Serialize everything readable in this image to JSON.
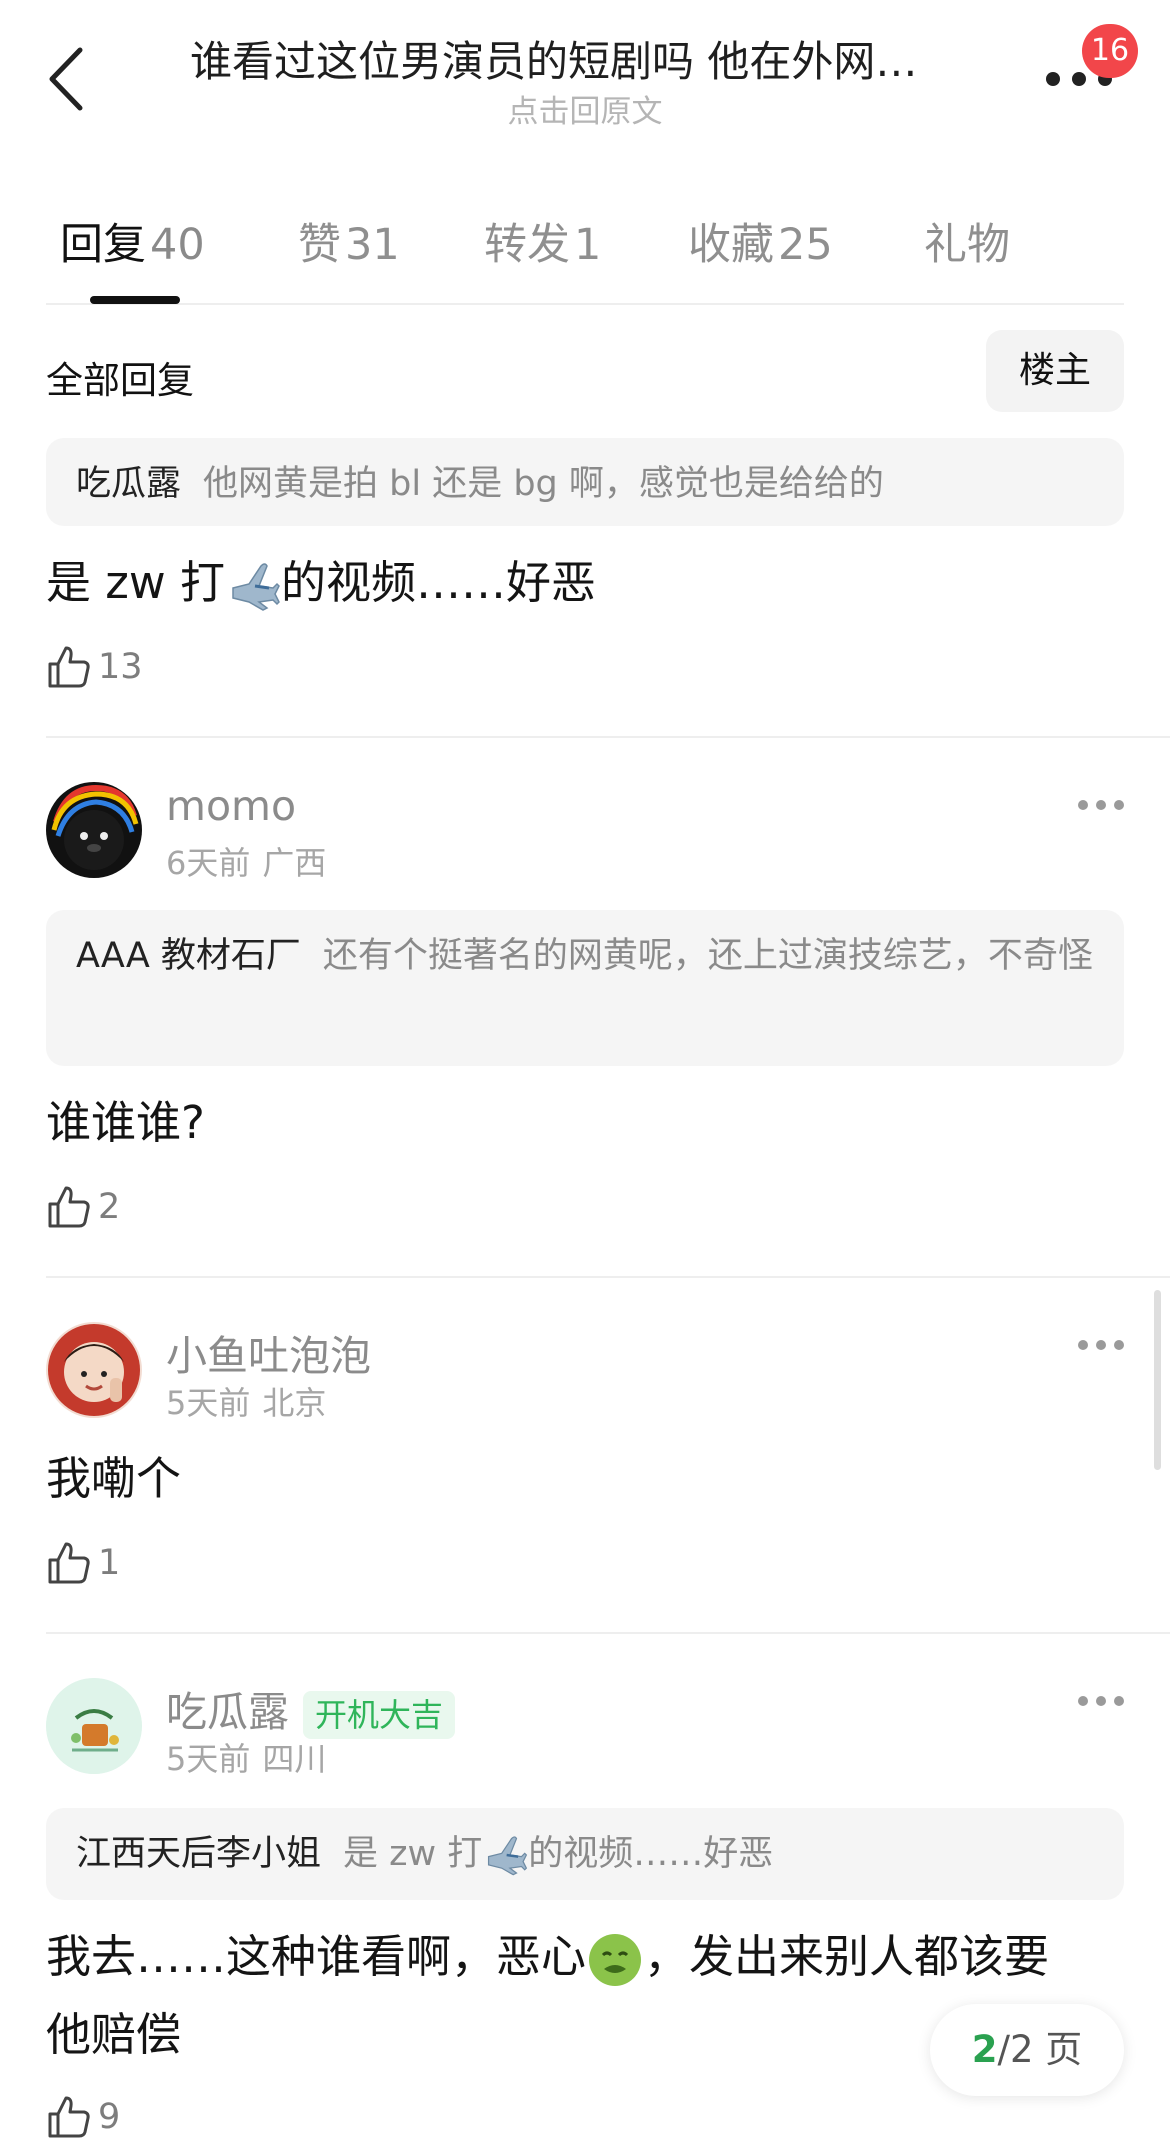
{
  "header": {
    "title": "谁看过这位男演员的短剧吗 他在外网…",
    "subtitle": "点击回原文",
    "notification_count": "16"
  },
  "tabs": [
    {
      "label": "回复",
      "count": "40"
    },
    {
      "label": "赞",
      "count": "31"
    },
    {
      "label": "转发",
      "count": "1"
    },
    {
      "label": "收藏",
      "count": "25"
    },
    {
      "label": "礼物",
      "count": ""
    }
  ],
  "section": {
    "label": "全部回复",
    "filter_button": "楼主"
  },
  "comments": [
    {
      "quote_user": "吃瓜露",
      "quote_text": "他网黄是拍 bl 还是 bg 啊，感觉也是给给的",
      "text_before": "是 zw 打",
      "text_after": "的视频……好恶",
      "likes": "13"
    },
    {
      "user": "momo",
      "time": "6天前",
      "location": "广西",
      "quote_user": "AAA 教材石厂",
      "quote_text": "还有个挺著名的网黄呢，还上过演技综艺，不奇怪",
      "text": "谁谁谁?",
      "likes": "2"
    },
    {
      "user": "小鱼吐泡泡",
      "time": "5天前",
      "location": "北京",
      "text": "我嘞个",
      "likes": "1"
    },
    {
      "user": "吃瓜露",
      "tag": "开机大吉",
      "time": "5天前",
      "location": "四川",
      "quote_user": "江西天后李小姐",
      "quote_text_before": "是 zw 打",
      "quote_text_after": "的视频……好恶",
      "text_line1_before": "我去……这种谁看啊，恶心",
      "text_line1_after": "，发出来别人都该要",
      "text_line2": "他赔偿",
      "likes": "9"
    }
  ],
  "pager": {
    "current": "2",
    "total": "/2 页"
  },
  "colors": {
    "accent_green": "#2aa150",
    "badge_red": "#f2464a",
    "tag_green": "#2fb55a"
  }
}
